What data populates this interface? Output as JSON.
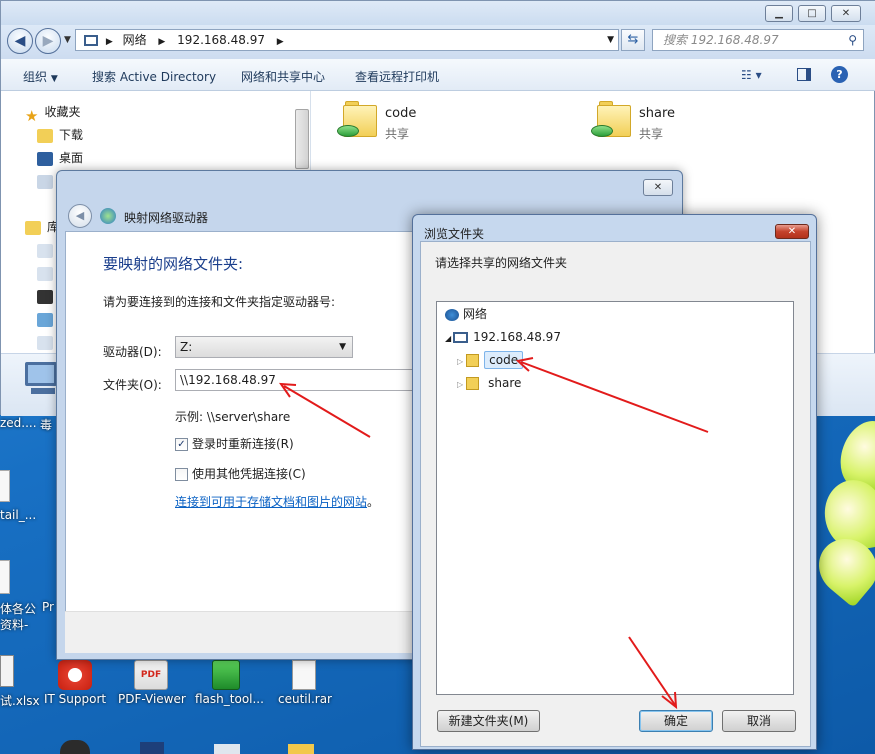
{
  "explorer": {
    "address": {
      "seg1": "网络",
      "seg2": "192.168.48.97"
    },
    "search_placeholder": "搜索 192.168.48.97",
    "toolbar": {
      "organize": "组织",
      "search_ad": "搜索 Active Directory",
      "network_center": "网络和共享中心",
      "printers": "查看远程打印机"
    },
    "nav": {
      "favorites": "收藏夹",
      "downloads": "下载",
      "desktop": "桌面",
      "libraries": "库"
    },
    "folders": [
      {
        "name": "code",
        "sub": "共享"
      },
      {
        "name": "share",
        "sub": "共享"
      }
    ]
  },
  "desktop": {
    "icons": [
      "zed....",
      "毒",
      "tail_...",
      "体各公",
      "资料-",
      "Pr",
      "试.xlsx",
      "IT Support",
      "PDF-Viewer",
      "flash_tool...",
      "ceutil.rar"
    ]
  },
  "map_dialog": {
    "title": "映射网络驱动器",
    "heading": "要映射的网络文件夹:",
    "instruction": "请为要连接到的连接和文件夹指定驱动器号:",
    "drive_label": "驱动器(D):",
    "drive_value": "Z:",
    "folder_label": "文件夹(O):",
    "folder_value": "\\\\192.168.48.97",
    "example": "示例: \\\\server\\share",
    "reconnect": "登录时重新连接(R)",
    "other_credentials": "使用其他凭据连接(C)",
    "link_text": "连接到可用于存储文档和图片的网站",
    "link_suffix": "。"
  },
  "browse_dialog": {
    "title": "浏览文件夹",
    "prompt": "请选择共享的网络文件夹",
    "tree": {
      "network": "网络",
      "host": "192.168.48.97",
      "code": "code",
      "share": "share"
    },
    "new_folder": "新建文件夹(M)",
    "ok": "确定",
    "cancel": "取消"
  }
}
